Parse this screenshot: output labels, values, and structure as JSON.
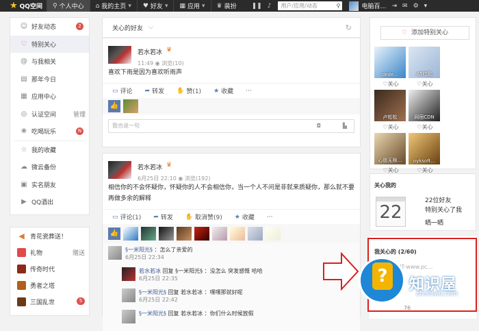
{
  "topbar": {
    "logo": "QQ空间",
    "nav": [
      {
        "label": "个人中心",
        "icon": "person-icon"
      },
      {
        "label": "我的主页",
        "icon": "home-icon"
      },
      {
        "label": "好友",
        "icon": "friends-icon"
      },
      {
        "label": "应用",
        "icon": "apps-icon"
      },
      {
        "label": "装扮",
        "icon": "shirt-icon"
      }
    ],
    "search_placeholder": "用户/应用/动态",
    "username": "电脑百…"
  },
  "leftnav": {
    "items": [
      {
        "label": "好友动态",
        "badge": "2"
      },
      {
        "label": "特别关心"
      },
      {
        "label": "与我相关"
      },
      {
        "label": "那年今日"
      },
      {
        "label": "应用中心"
      },
      {
        "label": "认证空间",
        "extra": "管理"
      },
      {
        "label": "吃喝玩乐",
        "badge": "N"
      },
      {
        "label": "我的收藏"
      },
      {
        "label": "微云备份"
      },
      {
        "label": "实名朋友"
      },
      {
        "label": "QQ酒出"
      }
    ]
  },
  "leftapps": {
    "items": [
      {
        "label": "青花瓷葬送！"
      },
      {
        "label": "礼物",
        "extra": "赠送"
      },
      {
        "label": "传奇时代"
      },
      {
        "label": "勇者之塔"
      },
      {
        "label": "三国乱世",
        "badge": "5"
      }
    ]
  },
  "feed": {
    "filter": "关心的好友",
    "posts": [
      {
        "author": "若水若冰",
        "time": "11:49",
        "views": "浏览(10)",
        "text": "喜欢下雨是因为喜欢听雨声",
        "actions": [
          "评论",
          "转发",
          "赞(1)",
          "收藏",
          "···"
        ],
        "comment_placeholder": "我也说一句"
      },
      {
        "author": "若水若冰",
        "time": "6月25日 22:10",
        "views": "浏览(192)",
        "text": "相信你的不会怀疑你，怀疑你的人不会相信你，当一个人不问是非就来质疑你，那么就不要再做多余的解释",
        "actions": [
          "评论(1)",
          "转发",
          "取消赞(9)",
          "收藏",
          "···"
        ],
        "comments": [
          {
            "who": "§一米阳光§",
            "text": "：怎么了亲爱的",
            "time": "6月25日 22:34"
          },
          {
            "who": "若水若冰",
            "text": "回复 §一米阳光§ ：没怎么 突发感慨 哈哈",
            "time": "6月25日 22:35",
            "reply": true
          },
          {
            "who": "§一米阳光§",
            "text": "回复 若水若冰 ：嘿嘿那就好呢",
            "time": "6月25日 22:42",
            "reply": true
          },
          {
            "who": "§一米阳光§",
            "text": "回复 若水若冰 ：你们什么时候放假",
            "time": "",
            "reply": true
          }
        ]
      }
    ]
  },
  "right": {
    "add_button": "添加特别关心",
    "friends": [
      {
        "name": "dede…",
        "follow": "关心"
      },
      {
        "name": "A5红歌",
        "follow": "关心"
      },
      {
        "name": "卢松松",
        "follow": "关心"
      },
      {
        "name": "网宿CDN",
        "follow": "关心"
      },
      {
        "name": "心愿无限…",
        "follow": "关心"
      },
      {
        "name": "oyksoft…",
        "follow": "关心"
      }
    ],
    "care_me": {
      "title": "关心我的",
      "day": "22",
      "line1": "22位好友",
      "line2": "特别关心了我",
      "line3": "晒一晒"
    },
    "my_care": {
      "title": "我关心的 (2/60)",
      "url": "IT-www.pc…",
      "count": "76"
    }
  },
  "watermark": {
    "zh": "知识屋",
    "en": "zhishiwu.com"
  }
}
